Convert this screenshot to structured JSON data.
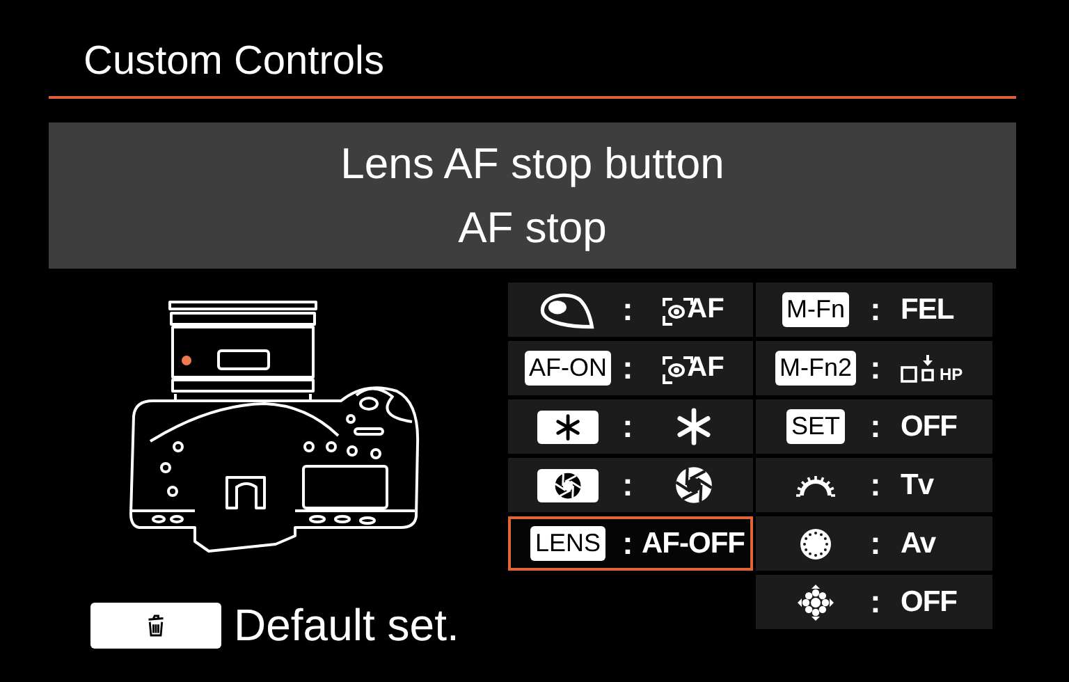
{
  "header": {
    "title": "Custom Controls"
  },
  "detail": {
    "button_name": "Lens AF stop button",
    "function": "AF stop"
  },
  "columns": [
    {
      "items": [
        {
          "key": {
            "kind": "eye"
          },
          "separator": ":",
          "value": {
            "kind": "af-point",
            "label": "AF"
          },
          "selected": false
        },
        {
          "key": {
            "kind": "text",
            "label": "AF-ON"
          },
          "separator": ":",
          "value": {
            "kind": "af-point",
            "label": "AF"
          },
          "selected": false
        },
        {
          "key": {
            "kind": "asterisk"
          },
          "separator": ":",
          "value": {
            "kind": "asterisk"
          },
          "selected": false
        },
        {
          "key": {
            "kind": "aperture"
          },
          "separator": ":",
          "value": {
            "kind": "aperture"
          },
          "selected": false
        },
        {
          "key": {
            "kind": "text",
            "label": "LENS"
          },
          "separator": ":",
          "value": {
            "kind": "text",
            "label": "AF-OFF"
          },
          "selected": true
        }
      ]
    },
    {
      "items": [
        {
          "key": {
            "kind": "text",
            "label": "M-Fn"
          },
          "separator": ":",
          "value": {
            "kind": "text",
            "label": "FEL"
          },
          "selected": false
        },
        {
          "key": {
            "kind": "text",
            "label": "M-Fn2"
          },
          "separator": ":",
          "value": {
            "kind": "drive",
            "label": "HP"
          },
          "selected": false
        },
        {
          "key": {
            "kind": "text",
            "label": "SET"
          },
          "separator": ":",
          "value": {
            "kind": "text",
            "label": "OFF"
          },
          "selected": false
        },
        {
          "key": {
            "kind": "main-dial"
          },
          "separator": ":",
          "value": {
            "kind": "text",
            "label": "Tv"
          },
          "selected": false
        },
        {
          "key": {
            "kind": "quick-dial"
          },
          "separator": ":",
          "value": {
            "kind": "text",
            "label": "Av"
          },
          "selected": false
        },
        {
          "key": {
            "kind": "multi-controller"
          },
          "separator": ":",
          "value": {
            "kind": "text",
            "label": "OFF"
          },
          "selected": false
        }
      ]
    }
  ],
  "footer": {
    "button": {
      "label": "Default set."
    }
  }
}
